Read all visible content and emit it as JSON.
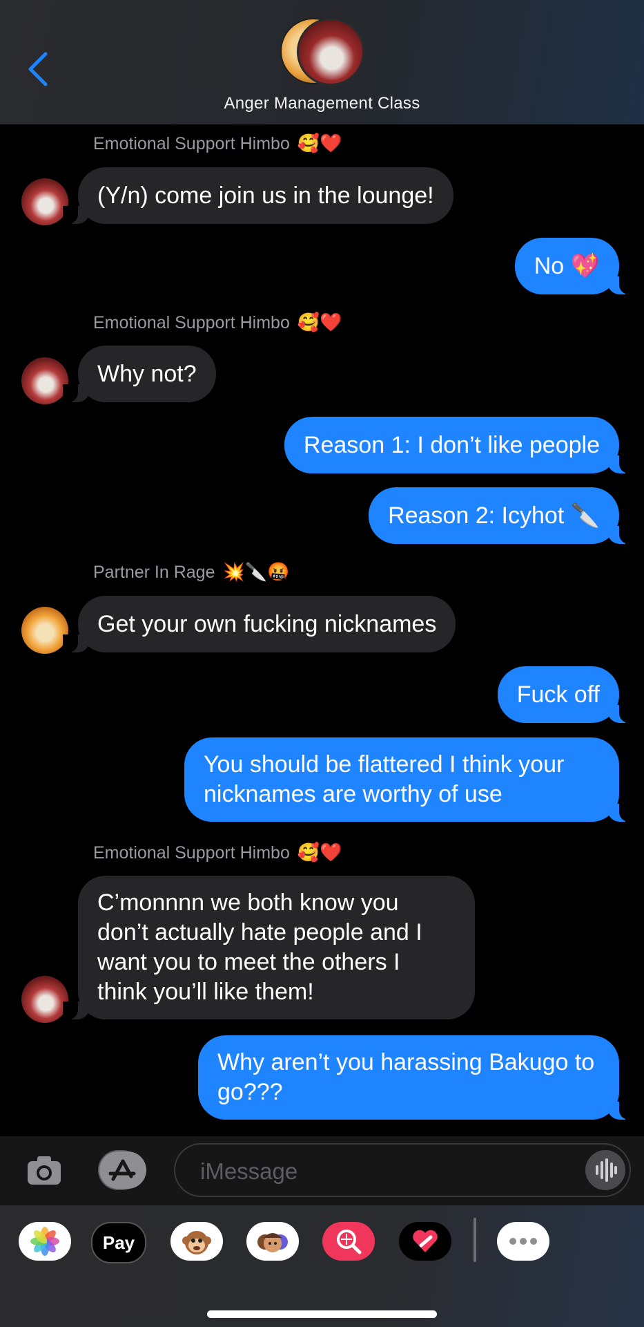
{
  "header": {
    "group_name": "Anger Management Class"
  },
  "senders": {
    "himbo": "Emotional Support Himbo",
    "himbo_emoji": "🥰❤️",
    "rage": "Partner In Rage",
    "rage_emoji": "💥🔪🤬"
  },
  "messages": [
    "(Y/n) come join us in the lounge!",
    "No 💖",
    "Why not?",
    "Reason 1: I don’t like people",
    "Reason 2: Icyhot 🔪",
    "Get your own fucking nicknames",
    "Fuck off",
    "You should be flattered I think your nicknames are worthy of use",
    "C’monnnn we both know you don’t actually hate people and I want you to meet the others I think you’ll like them!",
    "Why aren’t you harassing Bakugo to go???"
  ],
  "input": {
    "placeholder": "iMessage"
  },
  "drawer": {
    "apple_pay_label": "Pay",
    "apps": [
      "photos-app",
      "apple-pay-app",
      "animoji-app",
      "memoji-app",
      "image-search-app",
      "digital-touch-app",
      "more-apps"
    ]
  },
  "colors": {
    "outgoing_bubble": "#1f84ff",
    "incoming_bubble": "#262628",
    "accent": "#1f84ff"
  }
}
